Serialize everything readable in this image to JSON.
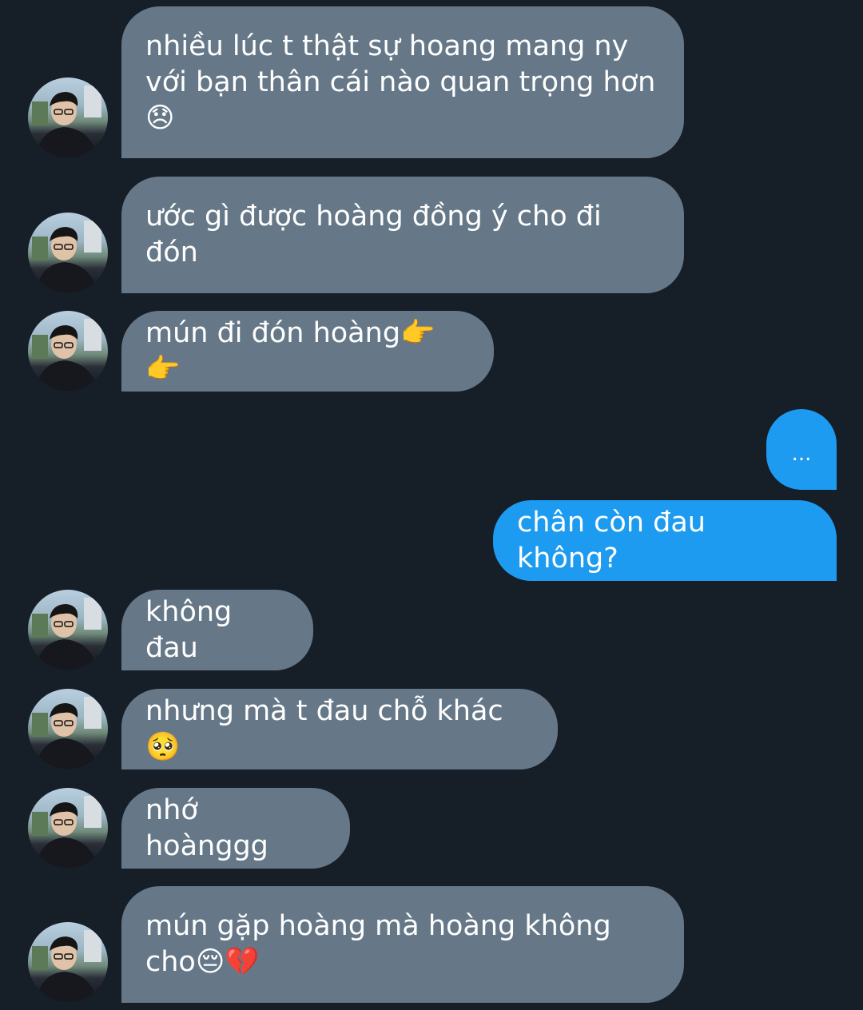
{
  "conversation": {
    "messages": [
      {
        "sender": "them",
        "text": "nhiều lúc t thật sự hoang mang ny với bạn thân cái nào quan trọng hơn 😞"
      },
      {
        "sender": "them",
        "text": "ước gì được hoàng đồng ý cho đi đón"
      },
      {
        "sender": "them",
        "text": "mún đi đón hoàng👉👉"
      },
      {
        "sender": "me",
        "text": "..."
      },
      {
        "sender": "me",
        "text": "chân còn đau không?"
      },
      {
        "sender": "them",
        "text": "không đau"
      },
      {
        "sender": "them",
        "text": "nhưng mà t đau chỗ khác🥺"
      },
      {
        "sender": "them",
        "text": "nhớ hoànggg"
      },
      {
        "sender": "them",
        "text": "mún gặp hoàng mà hoàng không cho😔💔"
      }
    ]
  },
  "colors": {
    "background": "#161e28",
    "incoming_bubble": "#667888",
    "outgoing_bubble": "#1d9bf0",
    "text": "#ffffff"
  },
  "icons": {
    "avatar": "contact-avatar-photo"
  }
}
